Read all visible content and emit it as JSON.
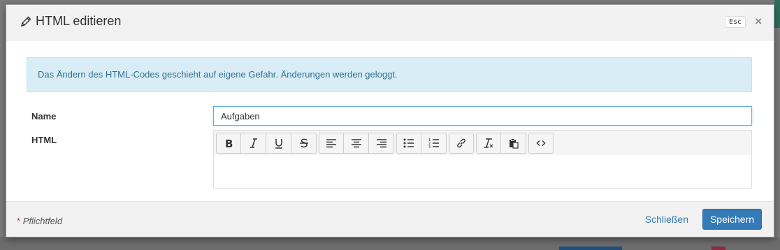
{
  "modal": {
    "title": "HTML editieren",
    "esc_label": "Esc",
    "close_symbol": "×",
    "alert": "Das Ändern des HTML-Codes geschieht auf eigene Gefahr. Änderungen werden geloggt.",
    "name_label": "Name",
    "name_value": "Aufgaben",
    "html_label": "HTML",
    "toolbar_groups": [
      [
        "bold-icon",
        "italic-icon",
        "underline-icon",
        "strikethrough-icon"
      ],
      [
        "align-left-icon",
        "align-center-icon",
        "align-right-icon"
      ],
      [
        "unordered-list-icon",
        "ordered-list-icon"
      ],
      [
        "link-icon"
      ],
      [
        "clear-format-icon",
        "paste-icon"
      ],
      [
        "code-view-icon"
      ]
    ],
    "footer": {
      "required_star": "*",
      "required_note": "Pflichtfeld",
      "close_label": "Schließen",
      "save_label": "Speichern"
    }
  },
  "colors": {
    "primary": "#337ab7",
    "alert_bg": "#d9edf7",
    "alert_text": "#31708f"
  }
}
